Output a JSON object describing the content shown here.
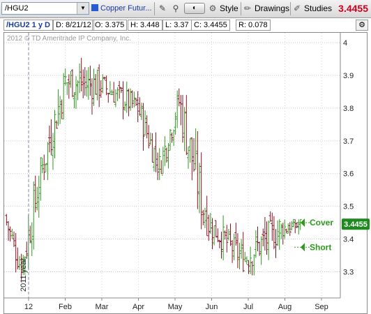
{
  "toolbar": {
    "symbol": "/HGU2",
    "description": "Copper Futur...",
    "style_label": "Style",
    "drawings_label": "Drawings",
    "studies_label": "Studies",
    "last_price": "3.4455",
    "icons": [
      "symbol-dropdown-icon",
      "description-icon",
      "drawing-tools-icon",
      "link-icon",
      "zoom-pill-icon",
      "style-icon",
      "drawings-icon",
      "studies-icon"
    ]
  },
  "infobar": {
    "symbol_period": "/HGU2 1 y D",
    "date": "D: 8/21/12",
    "open": "O: 3.375",
    "high": "H: 3.448",
    "low": "L: 3.37",
    "close": "C: 3.4455",
    "range": "R: 0.078"
  },
  "chart": {
    "watermark": "2012 © TD Ameritrade IP Company, Inc.",
    "year_marker": "2011 year",
    "current_price_tag": "3.4455",
    "annotations": [
      {
        "label": "Cover",
        "price": 3.45
      },
      {
        "label": "Short",
        "price": 3.375
      }
    ],
    "colors": {
      "up": "#2d9a1e",
      "down": "#8a1020",
      "price_tag": "#1e8a1e",
      "annotation": "#2d9a1e",
      "year_line": "#7a8aa8"
    }
  },
  "chart_data": {
    "type": "candlestick",
    "title": "",
    "xlabel": "",
    "ylabel": "",
    "ylim": [
      3.22,
      4.03
    ],
    "x_tick_labels": [
      "12",
      "Feb",
      "Mar",
      "Apr",
      "May",
      "Jun",
      "Jul",
      "Aug",
      "Sep"
    ],
    "y_tick_labels": [
      "3.3",
      "3.4",
      "3.5",
      "3.6",
      "3.7",
      "3.8",
      "3.9",
      "4"
    ],
    "series": [
      {
        "period": "Dec 2011",
        "start": 3.47,
        "end": 3.31,
        "high": 3.5,
        "low": 3.27
      },
      {
        "period": "Early Jan 2012",
        "start": 3.31,
        "end": 3.62,
        "high": 3.65,
        "low": 3.29
      },
      {
        "period": "Late Jan 2012",
        "start": 3.62,
        "end": 3.88,
        "high": 3.94,
        "low": 3.58
      },
      {
        "period": "Feb 2012",
        "start": 3.88,
        "end": 3.87,
        "high": 4.02,
        "low": 3.74
      },
      {
        "period": "Mar 2012",
        "start": 3.87,
        "end": 3.8,
        "high": 3.95,
        "low": 3.74
      },
      {
        "period": "Apr 2012",
        "start": 3.8,
        "end": 3.62,
        "high": 3.84,
        "low": 3.58
      },
      {
        "period": "Early May 2012",
        "start": 3.62,
        "end": 3.82,
        "high": 3.86,
        "low": 3.6
      },
      {
        "period": "Late May 2012",
        "start": 3.82,
        "end": 3.45,
        "high": 3.84,
        "low": 3.41
      },
      {
        "period": "Jun 2012",
        "start": 3.45,
        "end": 3.34,
        "high": 3.48,
        "low": 3.25
      },
      {
        "period": "Jul 2012",
        "start": 3.34,
        "end": 3.43,
        "high": 3.55,
        "low": 3.26
      },
      {
        "period": "Aug 2012",
        "start": 3.43,
        "end": 3.4455,
        "high": 3.46,
        "low": 3.29
      }
    ]
  }
}
